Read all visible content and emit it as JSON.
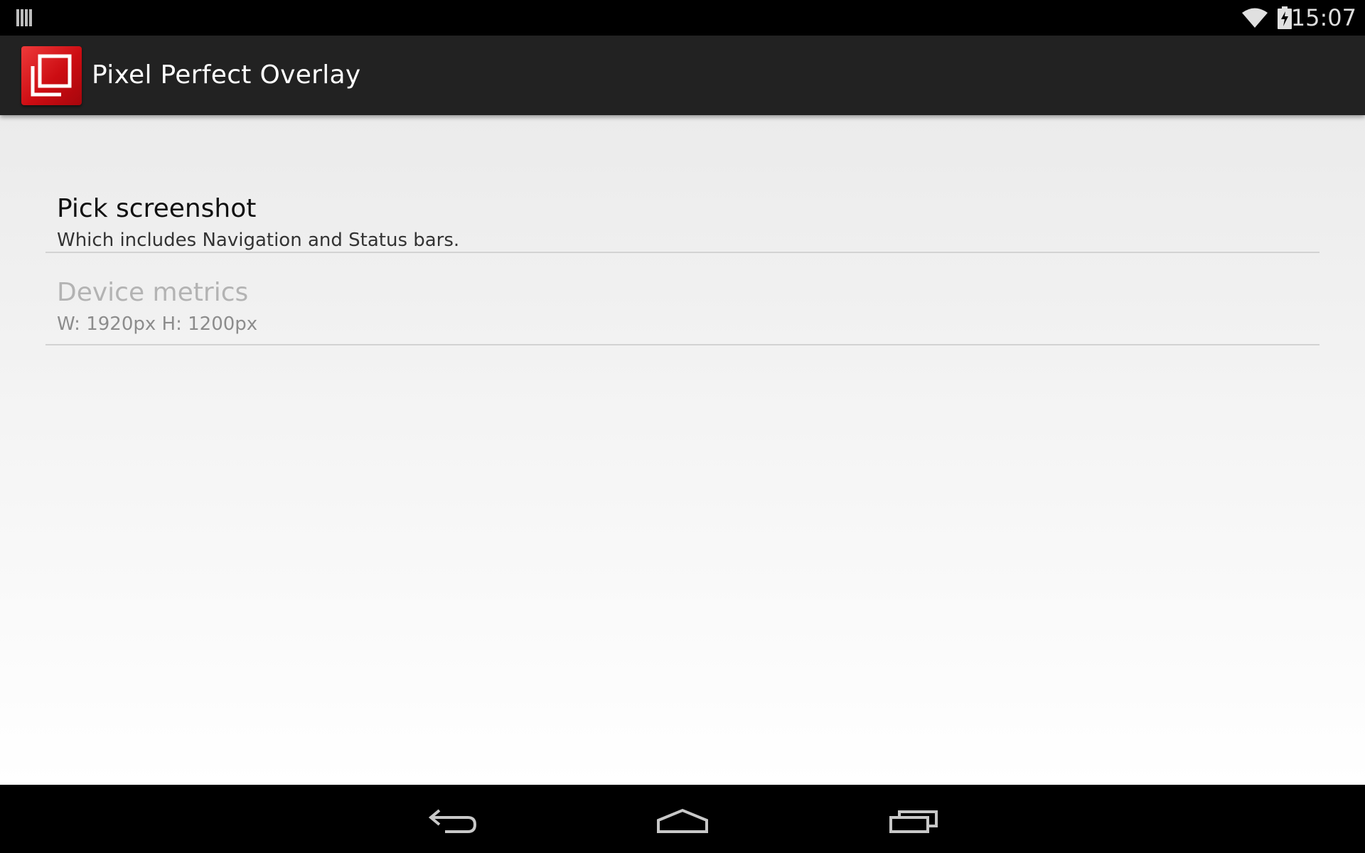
{
  "status_bar": {
    "time": "15:07",
    "left_icon": "notification-bars-icon",
    "icons": [
      "wifi-icon",
      "battery-charging-icon"
    ]
  },
  "action_bar": {
    "title": "Pixel Perfect Overlay",
    "logo_icon": "overlay-app-logo",
    "accent_color": "#d4141b",
    "background_color": "#222222"
  },
  "preferences": [
    {
      "title": "Pick screenshot",
      "summary": "Which includes Navigation and Status bars.",
      "enabled": true
    },
    {
      "title": "Device metrics",
      "summary": "W: 1920px H: 1200px",
      "enabled": false
    }
  ],
  "nav_bar": {
    "buttons": [
      "back-icon",
      "home-icon",
      "recents-icon"
    ]
  }
}
